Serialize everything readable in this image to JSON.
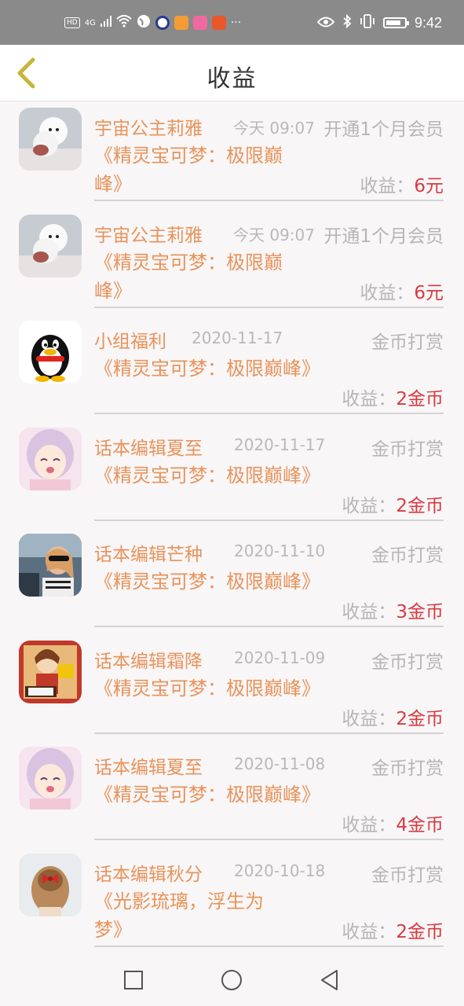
{
  "status_bar": {
    "hd": "HD",
    "network": "4G",
    "time": "9:42"
  },
  "header": {
    "title": "收益",
    "back_icon": "chevron-left-icon"
  },
  "items": [
    {
      "name": "宇宙公主莉雅",
      "date": "今天 09:07",
      "type": "开通1个月会员",
      "book": "《精灵宝可梦：极限巅峰》",
      "earn_label": "收益：",
      "amount": "6元",
      "avatar": "white-dog"
    },
    {
      "name": "宇宙公主莉雅",
      "date": "今天 09:07",
      "type": "开通1个月会员",
      "book": "《精灵宝可梦：极限巅峰》",
      "earn_label": "收益：",
      "amount": "6元",
      "avatar": "white-dog"
    },
    {
      "name": "小组福利",
      "date": "2020-11-17",
      "type": "金币打赏",
      "book": "《精灵宝可梦：极限巅峰》",
      "earn_label": "收益：",
      "amount": "2金币",
      "avatar": "penguin"
    },
    {
      "name": "话本编辑夏至",
      "date": "2020-11-17",
      "type": "金币打赏",
      "book": "《精灵宝可梦：极限巅峰》",
      "earn_label": "收益：",
      "amount": "2金币",
      "avatar": "anime-girl"
    },
    {
      "name": "话本编辑芒种",
      "date": "2020-11-10",
      "type": "金币打赏",
      "book": "《精灵宝可梦：极限巅峰》",
      "earn_label": "收益：",
      "amount": "3金币",
      "avatar": "car-selfie"
    },
    {
      "name": "话本编辑霜降",
      "date": "2020-11-09",
      "type": "金币打赏",
      "book": "《精灵宝可梦：极限巅峰》",
      "earn_label": "收益：",
      "amount": "2金币",
      "avatar": "illustration"
    },
    {
      "name": "话本编辑夏至",
      "date": "2020-11-08",
      "type": "金币打赏",
      "book": "《精灵宝可梦：极限巅峰》",
      "earn_label": "收益：",
      "amount": "4金币",
      "avatar": "anime-girl"
    },
    {
      "name": "话本编辑秋分",
      "date": "2020-10-18",
      "type": "金币打赏",
      "book": "《光影琉璃，浮生为梦》",
      "earn_label": "收益：",
      "amount": "2金币",
      "avatar": "hair-bow"
    }
  ],
  "navbar": {
    "recents_icon": "square-icon",
    "home_icon": "circle-icon",
    "back_icon": "triangle-back-icon"
  },
  "colors": {
    "accent_orange": "#e8935a",
    "amount_red": "#d83a42",
    "muted_gray": "#b6b6b6",
    "back_arrow": "#c9b43a"
  }
}
